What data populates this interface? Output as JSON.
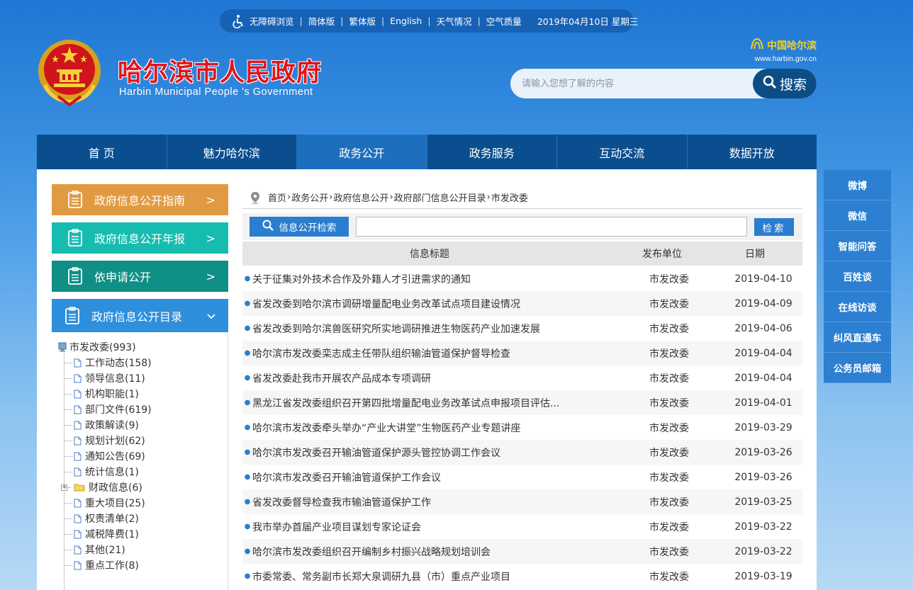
{
  "topbar": {
    "links": [
      "无障碍浏览",
      "简体版",
      "繁体版",
      "English",
      "天气情况",
      "空气质量"
    ],
    "date": "2019年04月10日 星期三"
  },
  "header": {
    "title": "哈尔滨市人民政府",
    "subtitle": "Harbin Municipal People 's Government",
    "brand_name": "中国哈尔滨",
    "brand_url": "www.harbin.gov.cn",
    "search_placeholder": "请输入您想了解的内容",
    "search_button": "搜索"
  },
  "nav": {
    "items": [
      "首 页",
      "魅力哈尔滨",
      "政务公开",
      "政务服务",
      "互动交流",
      "数据开放"
    ],
    "active_index": 2
  },
  "sidebar": {
    "buttons": [
      "政府信息公开指南",
      "政府信息公开年报",
      "依申请公开",
      "政府信息公开目录"
    ],
    "tree_root": "市发改委(993)",
    "tree_items": [
      {
        "label": "工作动态(158)",
        "type": "page"
      },
      {
        "label": "领导信息(11)",
        "type": "page"
      },
      {
        "label": "机构职能(1)",
        "type": "page"
      },
      {
        "label": "部门文件(619)",
        "type": "page"
      },
      {
        "label": "政策解读(9)",
        "type": "page"
      },
      {
        "label": "规划计划(62)",
        "type": "page"
      },
      {
        "label": "通知公告(69)",
        "type": "page"
      },
      {
        "label": "统计信息(1)",
        "type": "page"
      },
      {
        "label": "财政信息(6)",
        "type": "folder"
      },
      {
        "label": "重大项目(25)",
        "type": "page"
      },
      {
        "label": "权责清单(2)",
        "type": "page"
      },
      {
        "label": "减税降费(1)",
        "type": "page"
      },
      {
        "label": "其他(21)",
        "type": "page"
      },
      {
        "label": "重点工作(8)",
        "type": "page"
      }
    ]
  },
  "breadcrumb": [
    "首页",
    "政务公开",
    "政府信息公开",
    "政府部门信息公开目录",
    "市发改委"
  ],
  "info_search": {
    "button_label": "信息公开检索",
    "go_label": "检索",
    "value": ""
  },
  "table": {
    "headers": [
      "信息标题",
      "发布单位",
      "日期"
    ],
    "rows": [
      {
        "title": "关于征集对外技术合作及外籍人才引进需求的通知",
        "unit": "市发改委",
        "date": "2019-04-10"
      },
      {
        "title": "省发改委到哈尔滨市调研增量配电业务改革试点项目建设情况",
        "unit": "市发改委",
        "date": "2019-04-09"
      },
      {
        "title": "省发改委到哈尔滨兽医研究所实地调研推进生物医药产业加速发展",
        "unit": "市发改委",
        "date": "2019-04-06"
      },
      {
        "title": "哈尔滨市发改委栾志成主任带队组织输油管道保护督导检查",
        "unit": "市发改委",
        "date": "2019-04-04"
      },
      {
        "title": "省发改委赴我市开展农产品成本专项调研",
        "unit": "市发改委",
        "date": "2019-04-04"
      },
      {
        "title": "黑龙江省发改委组织召开第四批增量配电业务改革试点申报项目评估...",
        "unit": "市发改委",
        "date": "2019-04-01"
      },
      {
        "title": "哈尔滨市发改委牵头举办“产业大讲堂”生物医药产业专题讲座",
        "unit": "市发改委",
        "date": "2019-03-29"
      },
      {
        "title": "哈尔滨市发改委召开输油管道保护源头管控协调工作会议",
        "unit": "市发改委",
        "date": "2019-03-26"
      },
      {
        "title": "哈尔滨市发改委召开输油管道保护工作会议",
        "unit": "市发改委",
        "date": "2019-03-26"
      },
      {
        "title": "省发改委督导检查我市输油管道保护工作",
        "unit": "市发改委",
        "date": "2019-03-25"
      },
      {
        "title": "我市举办首届产业项目谋划专家论证会",
        "unit": "市发改委",
        "date": "2019-03-22"
      },
      {
        "title": "哈尔滨市发改委组织召开编制乡村振兴战略规划培训会",
        "unit": "市发改委",
        "date": "2019-03-22"
      },
      {
        "title": "市委常委、常务副市长郑大泉调研九县（市）重点产业项目",
        "unit": "市发改委",
        "date": "2019-03-19"
      }
    ]
  },
  "float_menu": [
    "微博",
    "微信",
    "智能问答",
    "百姓谈",
    "在线访谈",
    "纠风直通车",
    "公务员邮箱"
  ],
  "colors": {
    "nav_bg": "#0a4e8f",
    "nav_active": "#1d6fbe",
    "title_red": "#e4141b",
    "guide_orange": "#e29a42",
    "annual_teal": "#17bcb0",
    "apply_green": "#0f8f86",
    "catalog_blue": "#2e8fdc",
    "float_blue": "#2c7fd1"
  }
}
